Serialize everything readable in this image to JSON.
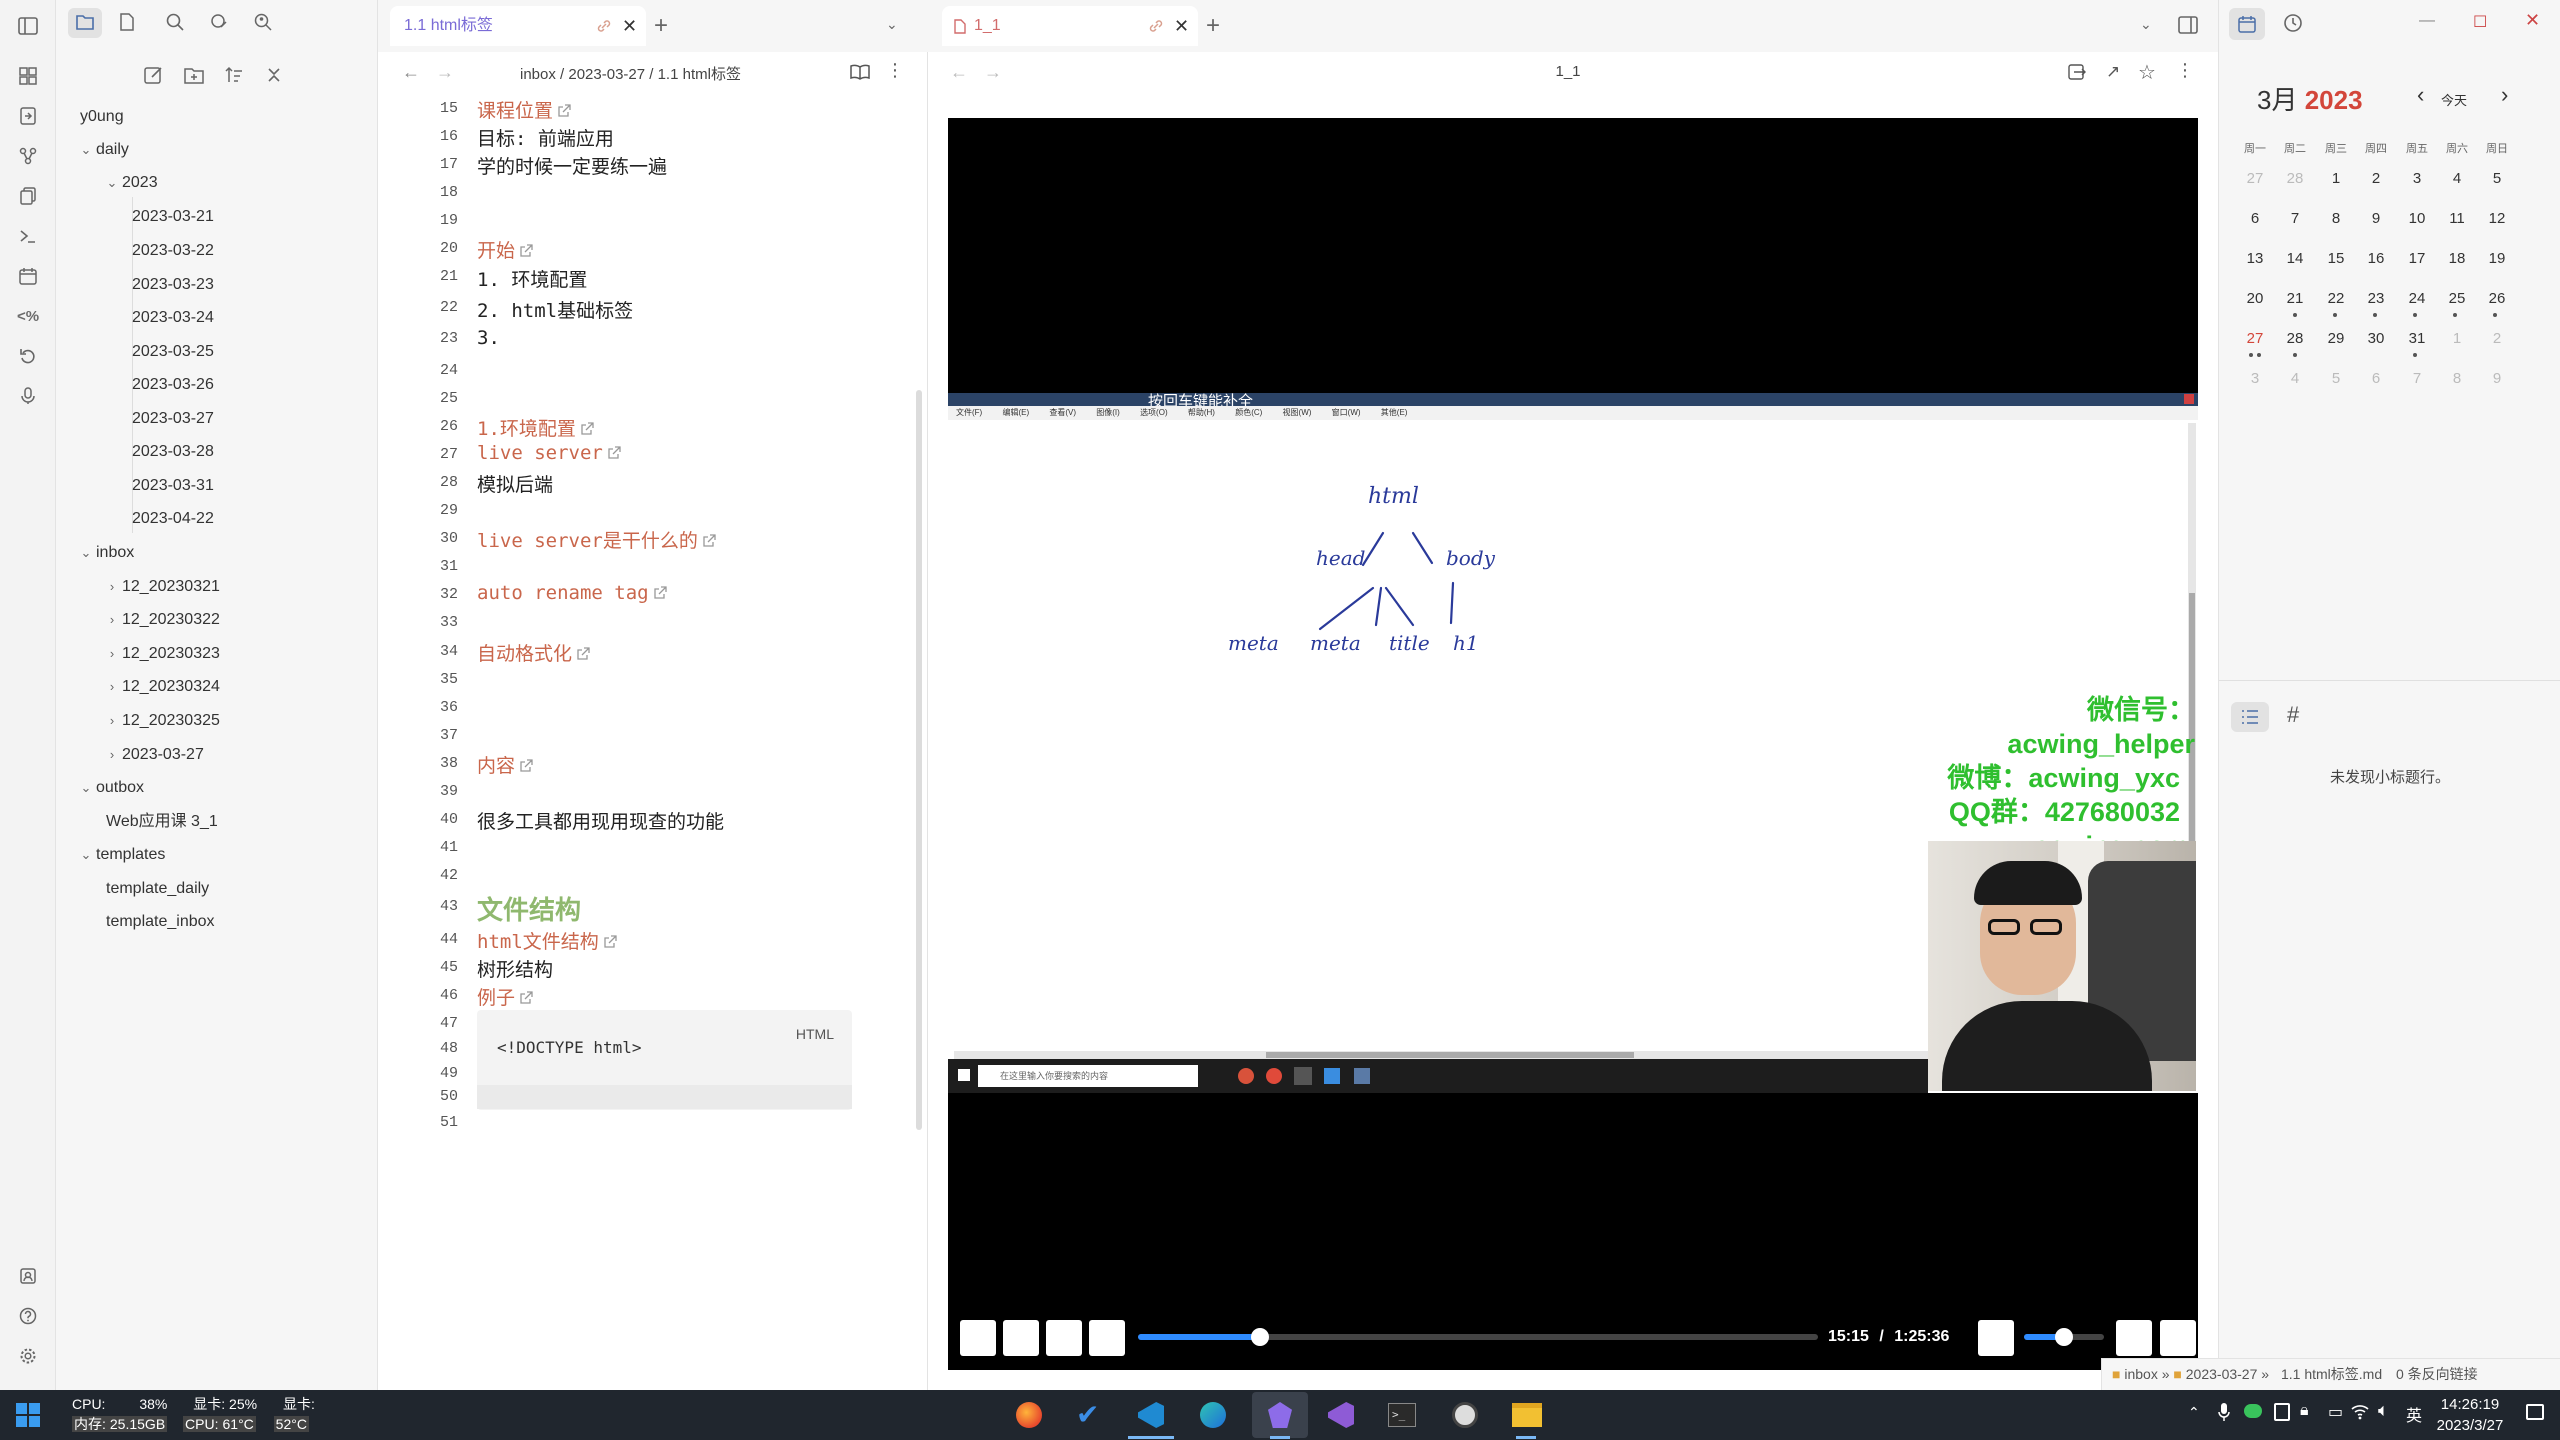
{
  "colors": {
    "accent": "#7a6bd6",
    "link": "#c9664b",
    "heading_green": "#8fb86e",
    "today_red": "#d3463a"
  },
  "left_tab": {
    "title": "1.1 html标签"
  },
  "right_tab": {
    "title": "1_1"
  },
  "sidebar": {
    "vault": "y0ung",
    "daily": "daily",
    "year": "2023",
    "dates": [
      "2023-03-21",
      "2023-03-22",
      "2023-03-23",
      "2023-03-24",
      "2023-03-25",
      "2023-03-26",
      "2023-03-27",
      "2023-03-28",
      "2023-03-31",
      "2023-04-22"
    ],
    "inbox": "inbox",
    "inbox_items": [
      "12_20230321",
      "12_20230322",
      "12_20230323",
      "12_20230324",
      "12_20230325",
      "2023-03-27"
    ],
    "outbox": "outbox",
    "outbox_items": [
      "Web应用课 3_1"
    ],
    "templates": "templates",
    "template_items": [
      "template_daily",
      "template_inbox"
    ]
  },
  "editor": {
    "breadcrumb": "inbox / 2023-03-27 / 1.1 html标签",
    "lines": {
      "n15": "15",
      "n16": "16",
      "n17": "17",
      "n18": "18",
      "n19": "19",
      "n20": "20",
      "n21": "21",
      "n22": "22",
      "n23": "23",
      "n24": "24",
      "n25": "25",
      "n26": "26",
      "n27": "27",
      "n28": "28",
      "n29": "29",
      "n30": "30",
      "n31": "31",
      "n32": "32",
      "n33": "33",
      "n34": "34",
      "n35": "35",
      "n36": "36",
      "n37": "37",
      "n38": "38",
      "n39": "39",
      "n40": "40",
      "n41": "41",
      "n42": "42",
      "n43": "43",
      "n44": "44",
      "n45": "45",
      "n46": "46",
      "n47": "47",
      "n48": "48",
      "n49": "49",
      "n50": "50",
      "n51": "51"
    },
    "l15": "课程位置",
    "l16": "目标: 前端应用",
    "l17": "学的时候一定要练一遍",
    "l20": "开始",
    "l21": "1.  环境配置",
    "l22": "2.  html基础标签",
    "l23": "3.",
    "l26": "1.环境配置",
    "l27": "live server",
    "l28": "模拟后端",
    "l30": "live server是干什么的",
    "l32": "auto rename tag",
    "l34": "自动格式化",
    "l38": "内容",
    "l40": "很多工具都用现用现查的功能",
    "l43": "文件结构",
    "l44": "html文件结构",
    "l45": "树形结构",
    "l46": "例子",
    "code_lang": "HTML",
    "l48": "<!DOCTYPE html>"
  },
  "video": {
    "header_title": "1_1",
    "watermark": [
      "微信号：acwing_helper",
      "微博：acwing_yxc",
      "QQ群：427680032",
      "www.acwing.com"
    ],
    "inner_title": "按回车键能补全",
    "inner_menu": [
      "文件(F)",
      "编辑(E)",
      "查看(V)",
      "图像(I)",
      "选项(O)",
      "帮助(H)",
      "颜色(C)",
      "视图(W)",
      "窗口(W)",
      "其他(E)"
    ],
    "search_placeholder": "在这里输入你要搜索的内容",
    "current_time": "15:15",
    "separator": "/",
    "duration": "1:25:36",
    "progress": 0.18,
    "volume": 0.5,
    "drawing_labels": [
      "html",
      "head",
      "body",
      "meta",
      "meta",
      "title",
      "h1"
    ]
  },
  "calendar": {
    "month": "3月",
    "year": "2023",
    "today_btn": "今天",
    "weekdays": [
      "周一",
      "周二",
      "周三",
      "周四",
      "周五",
      "周六",
      "周日"
    ],
    "rows": [
      [
        "27",
        "28",
        "1",
        "2",
        "3",
        "4",
        "5"
      ],
      [
        "6",
        "7",
        "8",
        "9",
        "10",
        "11",
        "12"
      ],
      [
        "13",
        "14",
        "15",
        "16",
        "17",
        "18",
        "19"
      ],
      [
        "20",
        "21",
        "22",
        "23",
        "24",
        "25",
        "26"
      ],
      [
        "27",
        "28",
        "29",
        "30",
        "31",
        "1",
        "2"
      ],
      [
        "3",
        "4",
        "5",
        "6",
        "7",
        "8",
        "9"
      ]
    ],
    "outline_empty": "未发现小标题行。"
  },
  "statusbar": {
    "path": [
      "inbox",
      "»",
      "2023-03-27",
      "»",
      "1.1 html标签.md"
    ],
    "backlinks": "0 条反向链接"
  },
  "taskbar": {
    "cpu_label": "CPU:",
    "cpu_value": "38%",
    "gpu_label": "显卡:",
    "gpu_value": "25%",
    "mem_label": "内存:",
    "mem_value": "25.15GB",
    "cpu_temp_label": "CPU:",
    "cpu_temp_value": "61°C",
    "gpu2_label": "显卡:",
    "gpu_temp_value": "52°C",
    "ime": "英",
    "time": "14:26:19",
    "date": "2023/3/27"
  }
}
